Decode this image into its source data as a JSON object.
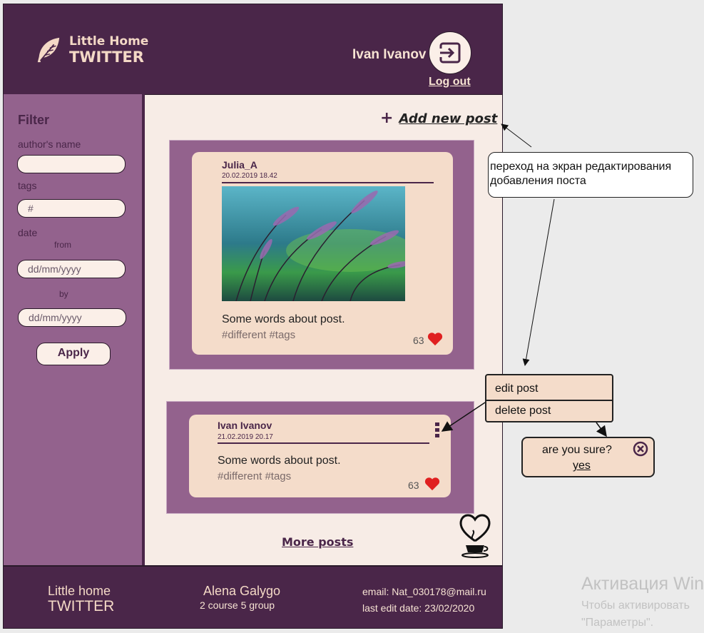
{
  "header": {
    "logo_line1": "Little Home",
    "logo_line2": "TWITTER",
    "user_name": "Ivan Ivanov",
    "logout_label": "Log out"
  },
  "filter": {
    "title": "Filter",
    "author_label": "author's name",
    "author_value": "",
    "tags_label": "tags",
    "tags_placeholder": "#",
    "date_label": "date",
    "from_label": "from",
    "from_placeholder": "dd/mm/yyyy",
    "by_label": "by",
    "by_placeholder": "dd/mm/yyyy",
    "apply_label": "Apply"
  },
  "main": {
    "add_post_label": "Add new post",
    "more_posts_label": "More posts"
  },
  "posts": [
    {
      "author": "Julia_A",
      "date": "20.02.2019 18.42",
      "text": "Some words about post.",
      "tags": "#different #tags",
      "likes": "63"
    },
    {
      "author": "Ivan Ivanov",
      "date": "21.02.2019 20.17",
      "text": "Some words about post.",
      "tags": "#different #tags",
      "likes": "63"
    }
  ],
  "annotations": {
    "add_post_note": "переход на экран редактирования добавления поста",
    "menu_edit": "edit post",
    "menu_delete": "delete post",
    "confirm_question": "are you sure?",
    "confirm_yes": "yes"
  },
  "footer": {
    "brand_line1": "Little home",
    "brand_line2": "TWITTER",
    "author_name": "Alena Galygo",
    "author_group": "2 course 5 group",
    "email": "email: Nat_030178@mail.ru",
    "last_edit": "last edit date: 23/02/2020"
  },
  "watermark": {
    "line1": "Активация Win",
    "line2": "Чтобы активировать",
    "line3": "\"Параметры\"."
  },
  "colors": {
    "header_bg": "#4a2649",
    "sidebar_bg": "#93628d",
    "card_bg": "#f4dcca",
    "heart": "#e02020"
  }
}
